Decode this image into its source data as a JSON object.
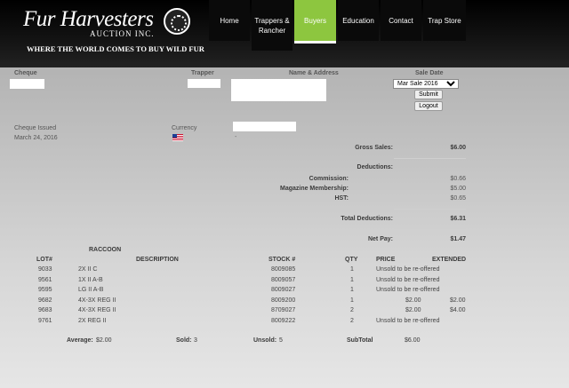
{
  "brand": {
    "logo_title": "Fur Harvesters",
    "logo_subtitle": "AUCTION INC.",
    "tagline": "WHERE THE WORLD COMES TO BUY WILD FUR"
  },
  "nav": [
    {
      "label": "Home"
    },
    {
      "label": "Trappers &\nRancher"
    },
    {
      "label": "Buyers",
      "active": true
    },
    {
      "label": "Education"
    },
    {
      "label": "Contact"
    },
    {
      "label": "Trap Store"
    }
  ],
  "form": {
    "cheque_label": "Cheque",
    "trapper_label": "Trapper",
    "name_label": "Name & Address",
    "sale_date_label": "Sale Date",
    "sale_selected": "Mar Sale 2016",
    "submit_label": "Submit",
    "logout_label": "Logout"
  },
  "cheque": {
    "issued_label": "Cheque Issued",
    "issued_date": "March 24, 2016",
    "currency_label": "Currency",
    "currency_value": "-"
  },
  "summary": {
    "gross_label": "Gross Sales:",
    "gross_value": "$6.00",
    "deductions_label": "Deductions:",
    "commission_label": "Commission:",
    "commission_value": "$0.66",
    "magazine_label": "Magazine Membership:",
    "magazine_value": "$5.00",
    "hst_label": "HST:",
    "hst_value": "$0.65",
    "total_deductions_label": "Total Deductions:",
    "total_deductions_value": "$6.31",
    "net_label": "Net Pay:",
    "net_value": "$1.47"
  },
  "lots": {
    "species": "RACCOON",
    "headers": {
      "lot": "LOT#",
      "description": "DESCRIPTION",
      "stock": "STOCK #",
      "qty": "QTY",
      "price": "PRICE",
      "extended": "EXTENDED"
    },
    "rows": [
      {
        "lot": "9033",
        "description": "2X II C",
        "stock": "8009085",
        "qty": "1",
        "price": "Unsold to be re-offered",
        "extended": ""
      },
      {
        "lot": "9561",
        "description": "1X II A-B",
        "stock": "8009057",
        "qty": "1",
        "price": "Unsold to be re-offered",
        "extended": ""
      },
      {
        "lot": "9595",
        "description": "LG II A-B",
        "stock": "8009027",
        "qty": "1",
        "price": "Unsold to be re-offered",
        "extended": ""
      },
      {
        "lot": "9682",
        "description": "4X-3X REG II",
        "stock": "8009200",
        "qty": "1",
        "price": "$2.00",
        "extended": "$2.00"
      },
      {
        "lot": "9683",
        "description": "4X-3X REG II",
        "stock": "8709027",
        "qty": "2",
        "price": "$2.00",
        "extended": "$4.00"
      },
      {
        "lot": "9761",
        "description": "2X REG II",
        "stock": "8009222",
        "qty": "2",
        "price": "Unsold to be re-offered",
        "extended": ""
      }
    ],
    "footer": {
      "average_label": "Average:",
      "average_value": "$2.00",
      "sold_label": "Sold:",
      "sold_value": "3",
      "unsold_label": "Unsold:",
      "unsold_value": "5",
      "subtotal_label": "SubTotal",
      "subtotal_value": "$6.00"
    }
  }
}
